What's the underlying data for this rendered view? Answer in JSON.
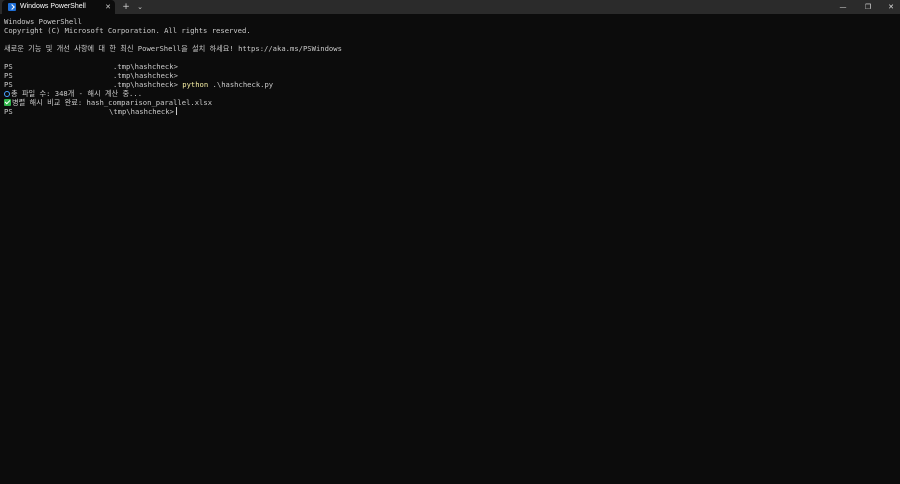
{
  "window": {
    "tab_title": "Windows PowerShell",
    "tab_close": "✕",
    "new_tab": "+",
    "tab_dropdown": "⌄",
    "minimize": "—",
    "maximize": "❐",
    "close": "✕",
    "tab_icon": "powershell-icon"
  },
  "terminal": {
    "banner_title": "Windows PowerShell",
    "copyright": "Copyright (C) Microsoft Corporation. All rights reserved.",
    "update_notice": "새로운 기능 및 개선 사항에 대 한 최신 PowerShell을 설치 하세요! https://aka.ms/PSWindows",
    "prompt_ps": "PS",
    "prompt_path_1": ".tmp\\hashcheck>",
    "prompt_path_2": ".tmp\\hashcheck>",
    "prompt_path_3": ".tmp\\hashcheck>",
    "command_keyword": "python",
    "command_arg": " .\\hashcheck.py",
    "output_line_1": "총 파일 수: 348개 - 해시 계산 중...",
    "output_line_2": "병렬 해시 비교 완료: hash_comparison_parallel.xlsx",
    "prompt_path_4": "\\tmp\\hashcheck>"
  },
  "colors": {
    "background": "#0c0c0c",
    "text": "#cccccc",
    "command": "#f9f1a5",
    "titlebar": "#2b2b2b"
  }
}
